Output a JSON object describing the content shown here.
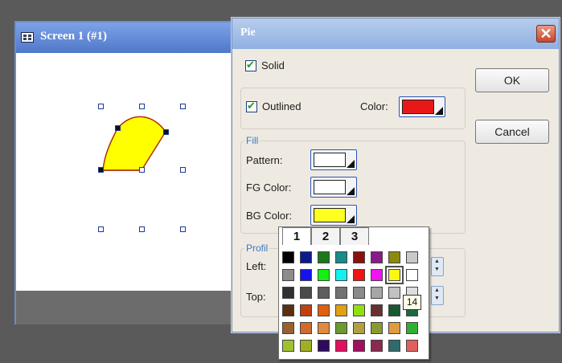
{
  "screen_window": {
    "title": "Screen 1 (#1)"
  },
  "pie_dialog": {
    "title": "Pie",
    "close": "✕",
    "solid_label": "Solid",
    "outlined_label": "Outlined",
    "color_label": "Color:",
    "outline_color": "#e81818",
    "ok_label": "OK",
    "cancel_label": "Cancel",
    "fill_group": "Fill",
    "pattern_label": "Pattern:",
    "pattern_color": "#ffffff",
    "fg_label": "FG Color:",
    "fg_color": "#ffffff",
    "bg_label": "BG Color:",
    "bg_color": "#ffff22",
    "profile_group": "Profil",
    "left_label": "Left:",
    "top_label": "Top:"
  },
  "palette": {
    "tabs": [
      "1",
      "2",
      "3"
    ],
    "tooltip": "14",
    "selected_index": 14,
    "colors": [
      "#000000",
      "#0a1a8c",
      "#1a7a1a",
      "#1a8a8a",
      "#8a1010",
      "#8a1a8a",
      "#8a8a10",
      "#c8c8c8",
      "#8c8c8c",
      "#1414f0",
      "#14f014",
      "#14f0f0",
      "#f01414",
      "#f014f0",
      "#f8f814",
      "#ffffff",
      "#303030",
      "#4a4a4a",
      "#5e5e5e",
      "#727272",
      "#8a8a8a",
      "#a6a6a6",
      "#c2c2c2",
      "#dedede",
      "#5a3010",
      "#c04010",
      "#e06010",
      "#e0a010",
      "#90e010",
      "#6a3030",
      "#185a30",
      "#1a6a40",
      "#9a6030",
      "#d06a30",
      "#e08a40",
      "#6a9a30",
      "#b0a040",
      "#8a9a30",
      "#e09a40",
      "#30b030",
      "#a0c030",
      "#a0b020",
      "#300a60",
      "#e01060",
      "#a01060",
      "#8a2a50",
      "#306a6a",
      "#e06060"
    ]
  }
}
